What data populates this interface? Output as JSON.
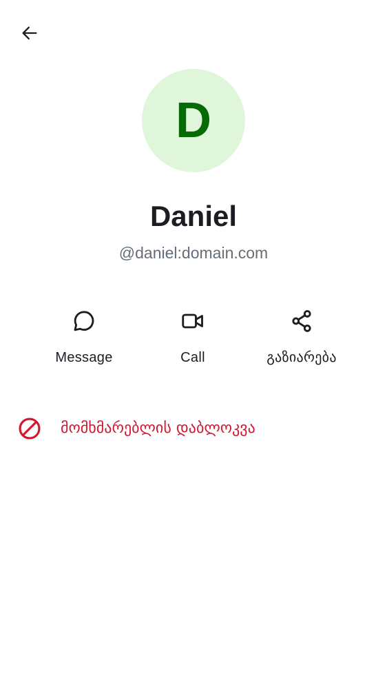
{
  "header": {
    "back_icon": "arrow-left-icon"
  },
  "profile": {
    "avatar_initial": "D",
    "display_name": "Daniel",
    "user_id": "@daniel:domain.com"
  },
  "actions": [
    {
      "label": "Message",
      "icon": "chat-bubble-icon"
    },
    {
      "label": "Call",
      "icon": "video-camera-icon"
    },
    {
      "label": "გაზიარება",
      "icon": "share-icon"
    }
  ],
  "block_user": {
    "label": "მომხმარებლის დაბლოკვა",
    "icon": "block-icon"
  },
  "colors": {
    "avatar_bg": "#dff6da",
    "avatar_fg": "#056b05",
    "text_primary": "#1b1d22",
    "text_secondary": "#656d77",
    "critical": "#d1182f"
  }
}
